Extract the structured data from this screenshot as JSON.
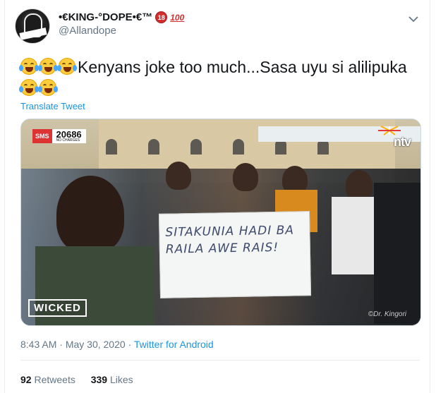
{
  "user": {
    "display_name": "•€KING-°DOPE•€™",
    "badge_18": "18",
    "badge_100": "100",
    "handle": "@Allandope"
  },
  "tweet": {
    "text_line1": "Kenyans joke too much...Sasa uyu si alilipuka",
    "translate_label": "Translate Tweet"
  },
  "media": {
    "sms_label": "SMS",
    "sms_code": "20686",
    "sms_sub": "NO CHARGES",
    "channel": "ntv",
    "sign_line1": "SITAKUNIA HADI BA",
    "sign_line2": "RAILA AWE RAIS!",
    "show_logo": "WICKED",
    "credit": "©Dr. Kingori"
  },
  "meta": {
    "time": "8:43 AM",
    "date": "May 30, 2020",
    "separator": "·",
    "source": "Twitter for Android"
  },
  "stats": {
    "retweets_count": "92",
    "retweets_label": "Retweets",
    "likes_count": "339",
    "likes_label": "Likes"
  }
}
